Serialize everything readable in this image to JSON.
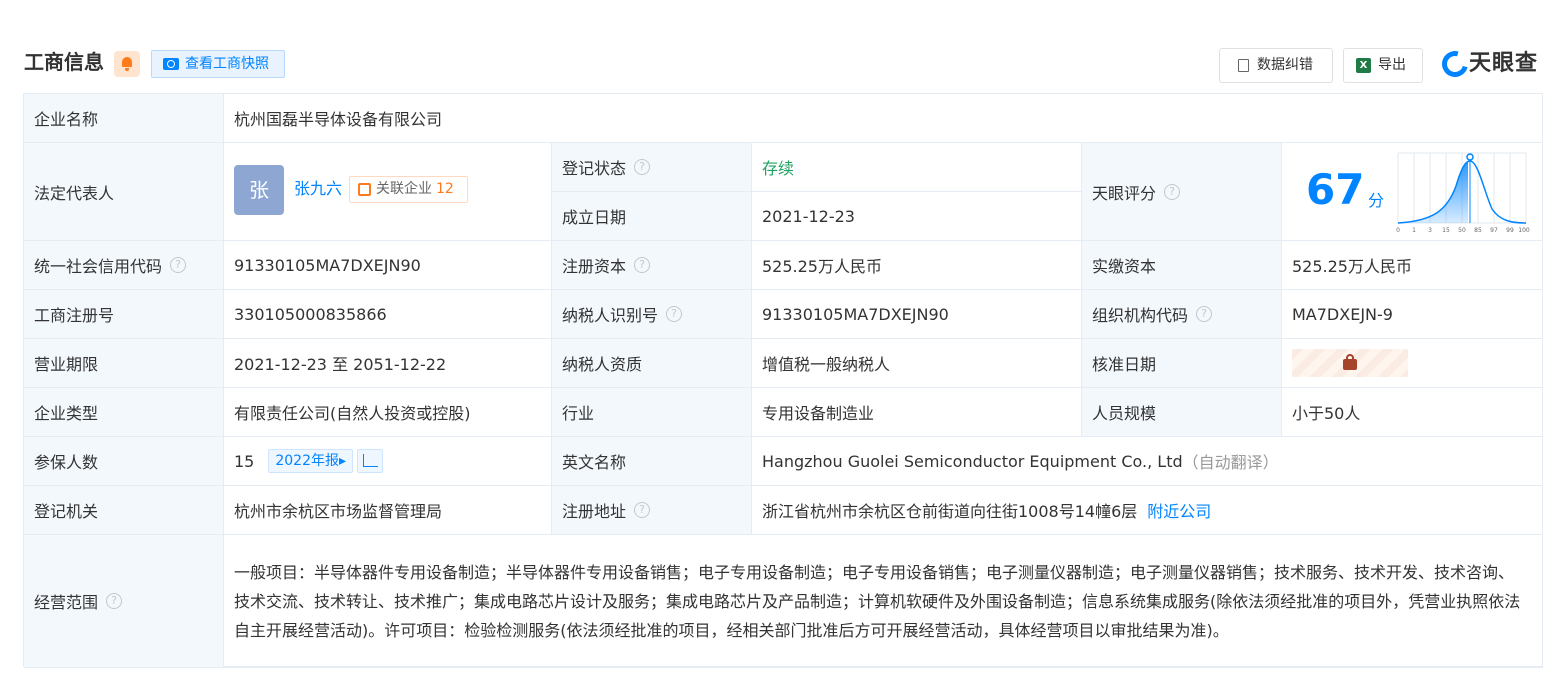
{
  "header": {
    "title": "工商信息",
    "snapshot_btn": "查看工商快照",
    "correct_btn": "数据纠错",
    "export_btn": "导出",
    "export_icon_text": "X",
    "logo": "天眼查"
  },
  "table": {
    "company_name": {
      "label": "企业名称",
      "value": "杭州国磊半导体设备有限公司"
    },
    "legal_rep": {
      "label": "法定代表人",
      "avatar": "张",
      "name": "张九六",
      "related_label": "关联企业",
      "related_count": "12"
    },
    "reg_status": {
      "label": "登记状态",
      "value": "存续"
    },
    "found_date": {
      "label": "成立日期",
      "value": "2021-12-23"
    },
    "tianyan_score": {
      "label": "天眼评分",
      "value": "67",
      "unit": "分",
      "axis_ticks": [
        "0",
        "1",
        "3",
        "15",
        "50",
        "85",
        "97",
        "99",
        "100"
      ]
    },
    "credit_code": {
      "label": "统一社会信用代码",
      "value": "91330105MA7DXEJN90"
    },
    "reg_capital": {
      "label": "注册资本",
      "value": "525.25万人民币"
    },
    "paid_capital": {
      "label": "实缴资本",
      "value": "525.25万人民币"
    },
    "reg_number": {
      "label": "工商注册号",
      "value": "330105000835866"
    },
    "taxpayer_id": {
      "label": "纳税人识别号",
      "value": "91330105MA7DXEJN90"
    },
    "org_code": {
      "label": "组织机构代码",
      "value": "MA7DXEJN-9"
    },
    "biz_term": {
      "label": "营业期限",
      "value": "2021-12-23 至 2051-12-22"
    },
    "taxpayer_qual": {
      "label": "纳税人资质",
      "value": "增值税一般纳税人"
    },
    "approve_date": {
      "label": "核准日期"
    },
    "company_type": {
      "label": "企业类型",
      "value": "有限责任公司(自然人投资或控股)"
    },
    "industry": {
      "label": "行业",
      "value": "专用设备制造业"
    },
    "staff_size": {
      "label": "人员规模",
      "value": "小于50人"
    },
    "insured": {
      "label": "参保人数",
      "value": "15",
      "report_badge": "2022年报▸"
    },
    "english_name": {
      "label": "英文名称",
      "value": "Hangzhou Guolei Semiconductor Equipment Co., Ltd",
      "note": "（自动翻译）"
    },
    "reg_authority": {
      "label": "登记机关",
      "value": "杭州市余杭区市场监督管理局"
    },
    "reg_address": {
      "label": "注册地址",
      "value": "浙江省杭州市余杭区仓前街道向往街1008号14幢6层",
      "nearby": "附近公司"
    },
    "biz_scope": {
      "label": "经营范围",
      "value": "一般项目：半导体器件专用设备制造；半导体器件专用设备销售；电子专用设备制造；电子专用设备销售；电子测量仪器制造；电子测量仪器销售；技术服务、技术开发、技术咨询、技术交流、技术转让、技术推广；集成电路芯片设计及服务；集成电路芯片及产品制造；计算机软硬件及外围设备制造；信息系统集成服务(除依法须经批准的项目外，凭营业执照依法自主开展经营活动)。许可项目：检验检测服务(依法须经批准的项目，经相关部门批准后方可开展经营活动，具体经营项目以审批结果为准)。"
    }
  }
}
